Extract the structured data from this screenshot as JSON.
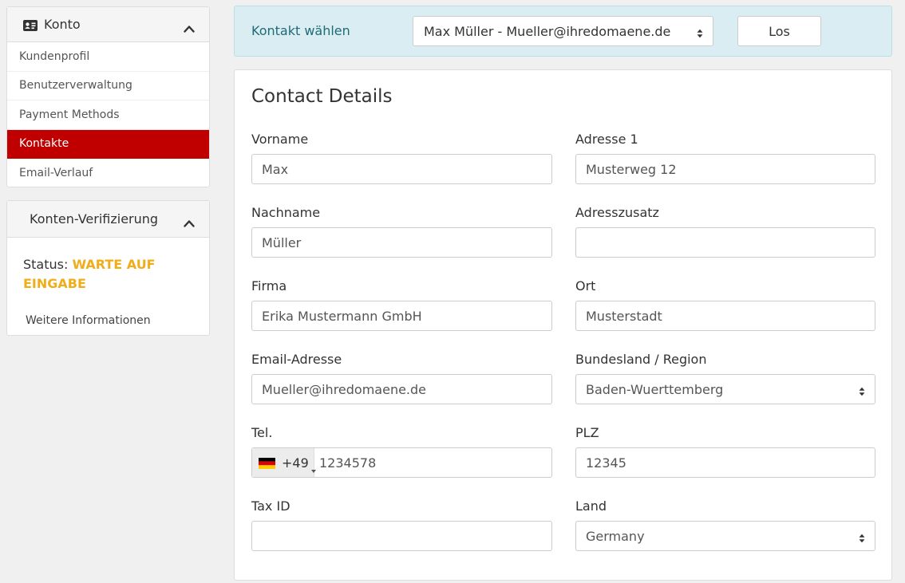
{
  "sidebar": {
    "account_panel": {
      "title": "Konto",
      "items": [
        {
          "label": "Kundenprofil"
        },
        {
          "label": "Benutzerverwaltung"
        },
        {
          "label": "Payment Methods"
        },
        {
          "label": "Kontakte",
          "active": true
        },
        {
          "label": "Email-Verlauf"
        }
      ]
    },
    "verification_panel": {
      "title": "Konten-Verifizierung",
      "status_label": "Status:",
      "status_value": "WARTE AUF EINGABE",
      "more_link": "Weitere Informationen"
    }
  },
  "chooser": {
    "label": "Kontakt wählen",
    "selected": "Max Müller - Mueller@ihredomaene.de",
    "go_button": "Los"
  },
  "contact": {
    "title": "Contact Details",
    "first_name": {
      "label": "Vorname",
      "value": "Max"
    },
    "last_name": {
      "label": "Nachname",
      "value": "Müller"
    },
    "company": {
      "label": "Firma",
      "value": "Erika Mustermann GmbH"
    },
    "email": {
      "label": "Email-Adresse",
      "value": "Mueller@ihredomaene.de"
    },
    "phone": {
      "label": "Tel.",
      "country_code": "+49",
      "number": "1234578"
    },
    "tax_id": {
      "label": "Tax ID",
      "value": ""
    },
    "address1": {
      "label": "Adresse 1",
      "value": "Musterweg 12"
    },
    "address2": {
      "label": "Adresszusatz",
      "value": ""
    },
    "city": {
      "label": "Ort",
      "value": "Musterstadt"
    },
    "state": {
      "label": "Bundesland / Region",
      "value": "Baden-Wuerttemberg"
    },
    "zip": {
      "label": "PLZ",
      "value": "12345"
    },
    "country": {
      "label": "Land",
      "value": "Germany"
    }
  },
  "colors": {
    "active_nav": "#c00000",
    "status_warning": "#f0ad1a",
    "chooser_bg": "#d9edf2",
    "chooser_text": "#1f6b76"
  },
  "icons": {
    "account": "id-card-icon",
    "collapse": "chevron-up-icon",
    "select": "sort-arrows-icon",
    "flag": "germany-flag-icon"
  }
}
